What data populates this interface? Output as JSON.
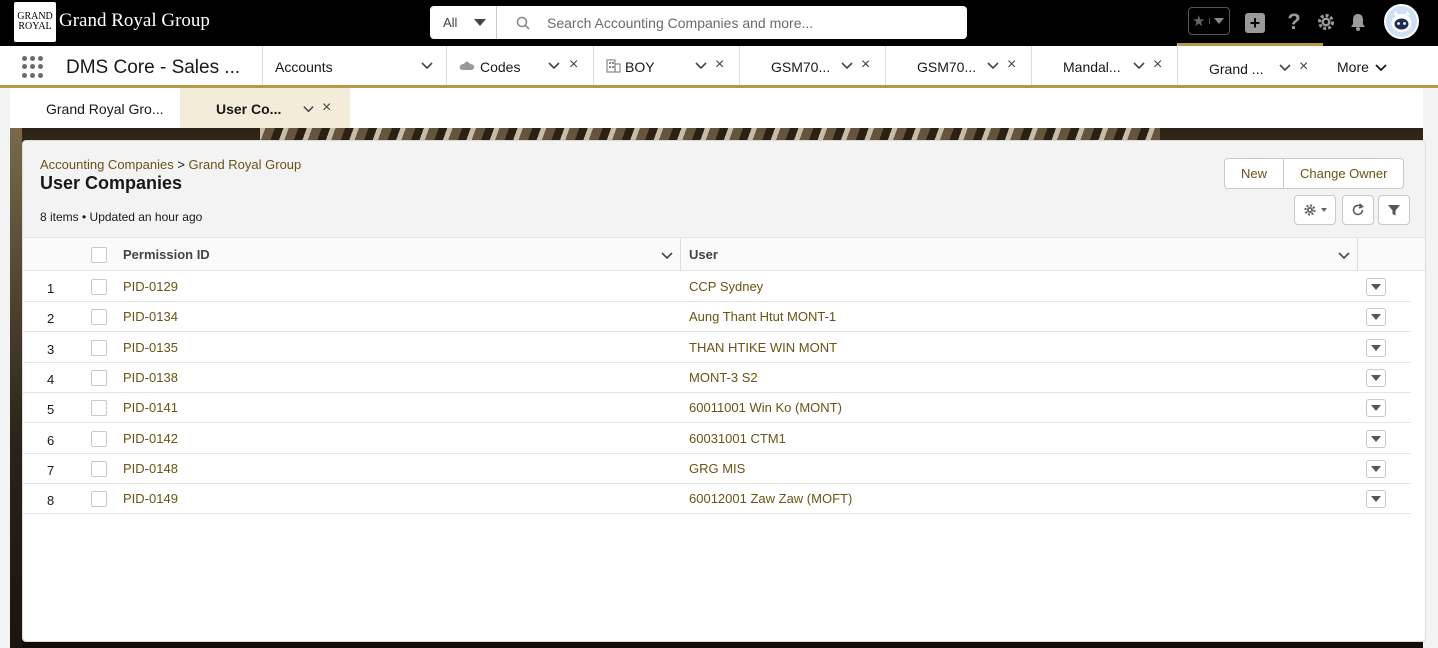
{
  "header": {
    "brand_logo": [
      "GRAND",
      "ROYAL"
    ],
    "brand_name": "Grand Royal Group",
    "search": {
      "scope": "All",
      "placeholder": "Search Accounting Companies and more..."
    }
  },
  "nav": {
    "app_name": "DMS Core - Sales ...",
    "tabs": [
      {
        "label": "Accounts",
        "closable": false
      },
      {
        "label": "Codes",
        "closable": true
      },
      {
        "label": "BOY",
        "closable": true
      },
      {
        "label": "GSM70...",
        "closable": true
      },
      {
        "label": "GSM70...",
        "closable": true
      },
      {
        "label": "Mandal...",
        "closable": true
      },
      {
        "label": "Grand ...",
        "closable": true,
        "active": true
      }
    ],
    "more_label": "More"
  },
  "subtabs": [
    {
      "label": "Grand Royal Gro..."
    },
    {
      "label": "User Co...",
      "active": true
    }
  ],
  "list": {
    "breadcrumb_parent": "Accounting Companies",
    "breadcrumb_separator": ">",
    "breadcrumb_record": "Grand Royal Group",
    "title": "User Companies",
    "meta": "8 items • Updated an hour ago",
    "buttons": {
      "new": "New",
      "change_owner": "Change Owner"
    },
    "columns": {
      "permission_id": "Permission ID",
      "user": "User"
    },
    "rows": [
      {
        "num": "1",
        "pid": "PID-0129",
        "user": "CCP Sydney"
      },
      {
        "num": "2",
        "pid": "PID-0134",
        "user": "Aung Thant Htut MONT-1"
      },
      {
        "num": "3",
        "pid": "PID-0135",
        "user": "THAN HTIKE WIN MONT"
      },
      {
        "num": "4",
        "pid": "PID-0138",
        "user": "MONT-3 S2"
      },
      {
        "num": "5",
        "pid": "PID-0141",
        "user": "60011001 Win Ko (MONT)"
      },
      {
        "num": "6",
        "pid": "PID-0142",
        "user": "60031001 CTM1"
      },
      {
        "num": "7",
        "pid": "PID-0148",
        "user": "GRG MIS"
      },
      {
        "num": "8",
        "pid": "PID-0149",
        "user": "60012001 Zaw Zaw (MOFT)"
      }
    ]
  },
  "colors": {
    "accent": "#b59a45",
    "link": "#6a5315",
    "header_bg": "#000000"
  }
}
